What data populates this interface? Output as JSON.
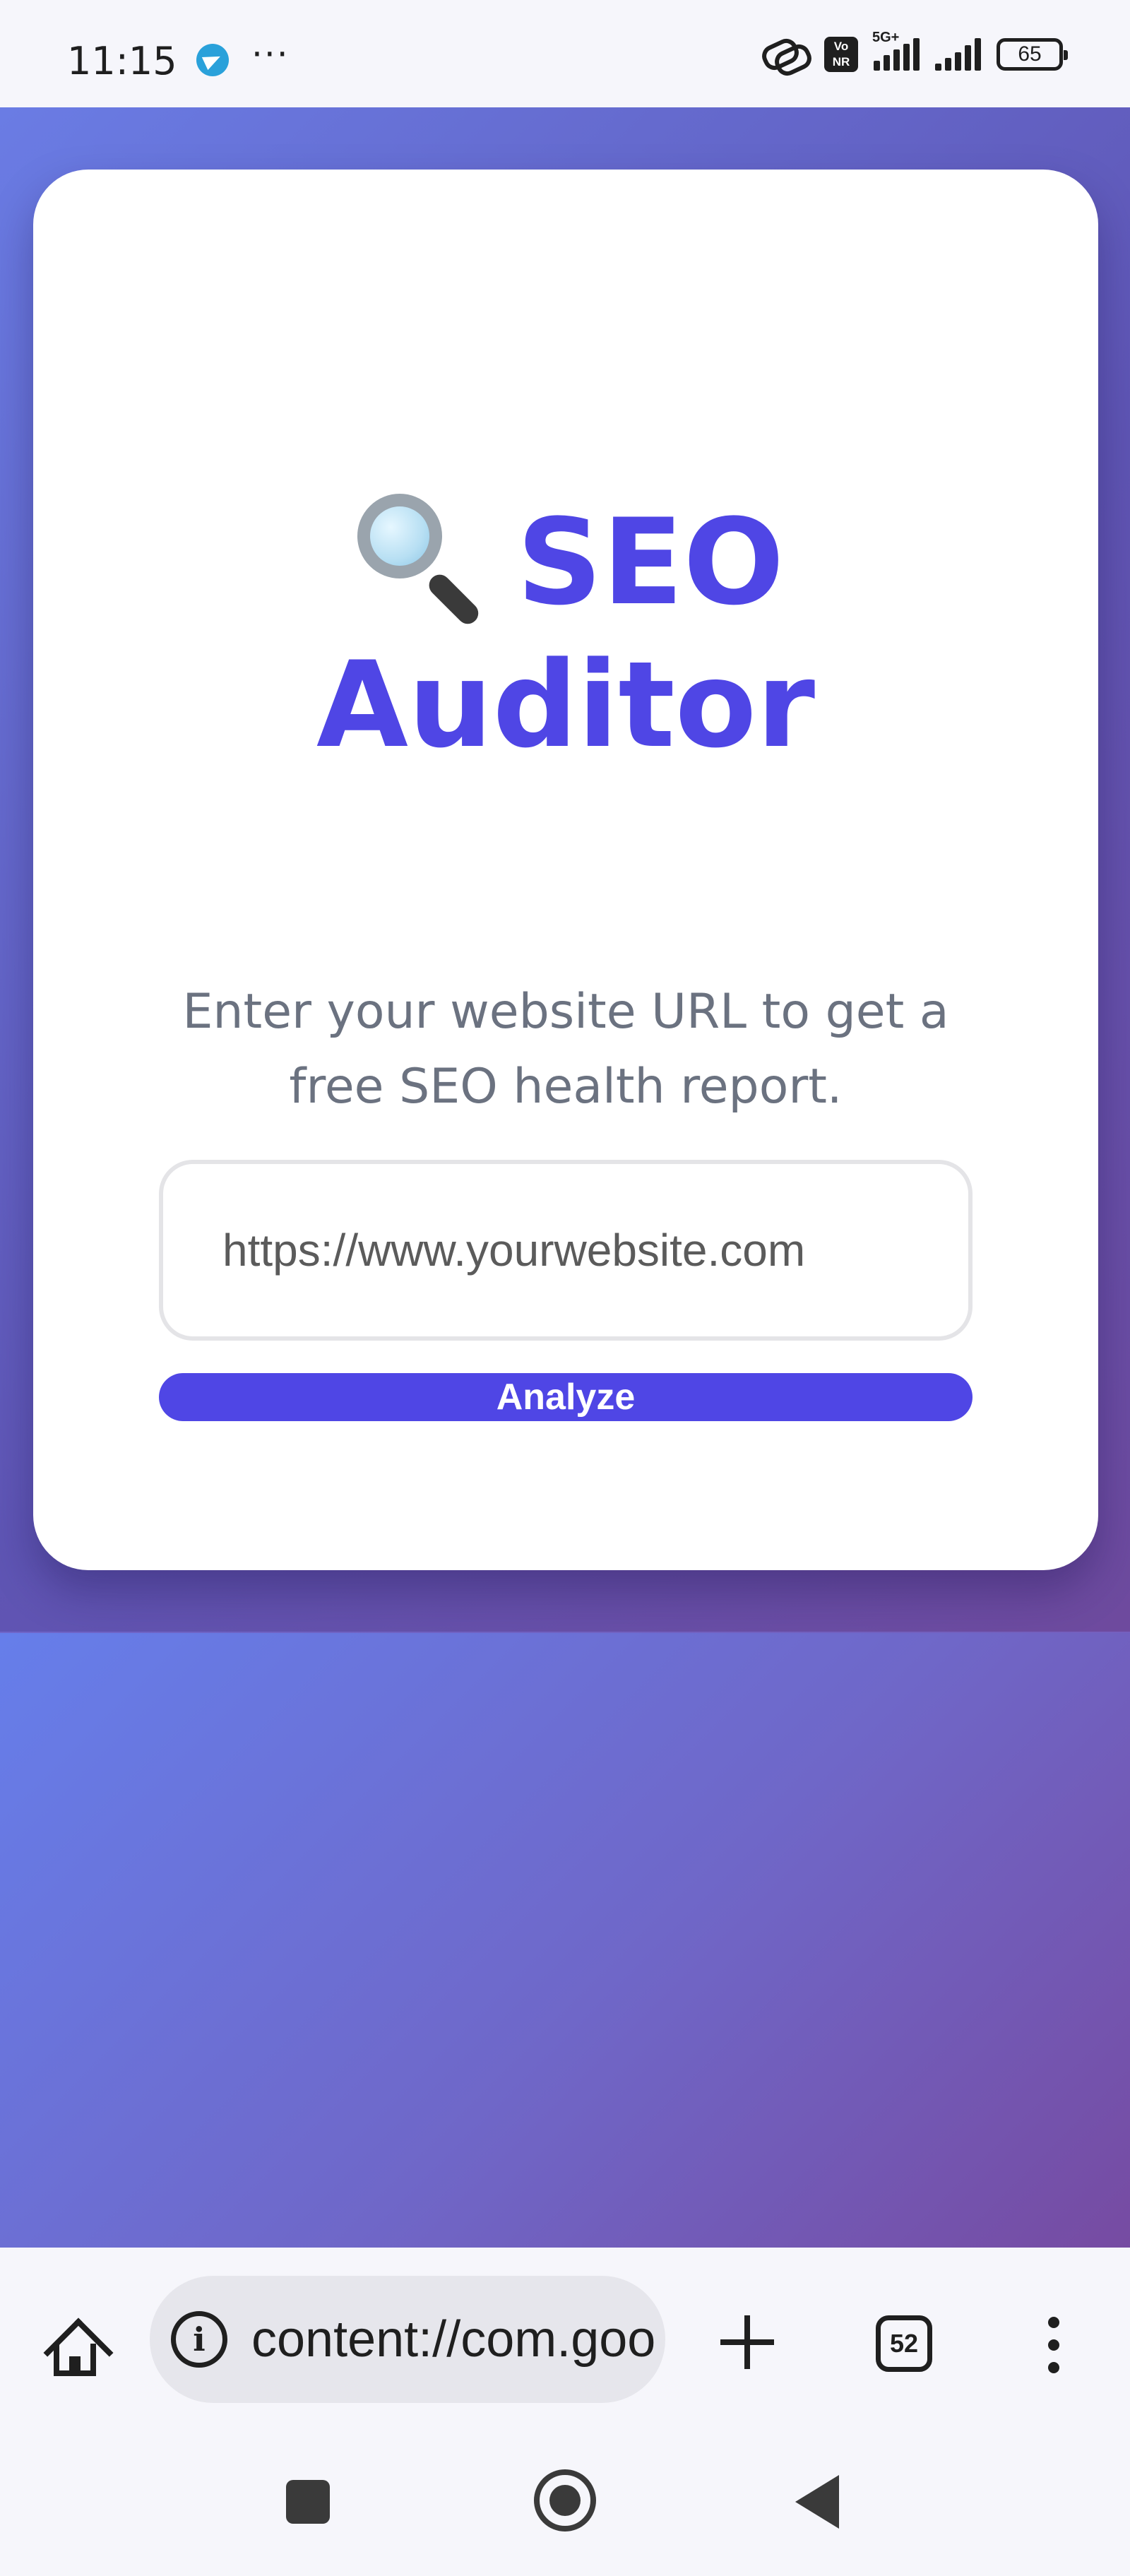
{
  "status_bar": {
    "time": "11:15",
    "overflow": "···",
    "network_label": "5G+",
    "volte_label": "Vo\nNR",
    "battery": "65"
  },
  "page": {
    "title_line1": "SEO",
    "title_line2": "Auditor",
    "title_icon": "magnifying-glass-icon",
    "subtitle_line1": "Enter your website URL to get a",
    "subtitle_line2": "free SEO health report.",
    "url_input": {
      "value": "",
      "placeholder": "https://www.yourwebsite.com"
    },
    "analyze_label": "Analyze",
    "colors": {
      "accent": "#4f46e5",
      "gradient_start": "#667eea",
      "gradient_end": "#764ba2"
    }
  },
  "browser": {
    "address": "content://com.goo",
    "tab_count": "52"
  }
}
